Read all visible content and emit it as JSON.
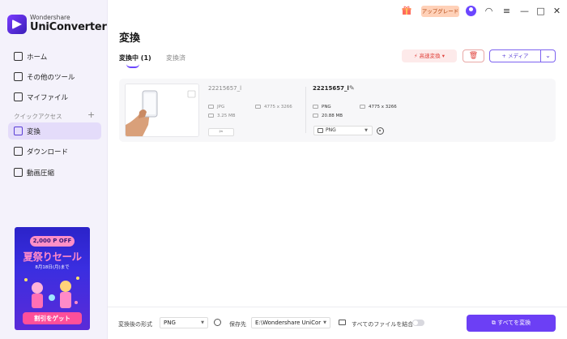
{
  "app": {
    "brand": "Wondershare",
    "name": "UniConverter"
  },
  "topbar": {
    "upgrade_label": "アップグレード"
  },
  "sidebar": {
    "items": [
      {
        "label": "ホーム",
        "icon": "home-icon"
      },
      {
        "label": "その他のツール",
        "icon": "toolbox-icon"
      },
      {
        "label": "マイファイル",
        "icon": "file-icon"
      }
    ],
    "section_label": "クイックアクセス",
    "quick_items": [
      {
        "label": "変換",
        "icon": "convert-icon",
        "active": true
      },
      {
        "label": "ダウンロード",
        "icon": "download-icon"
      },
      {
        "label": "動画圧縮",
        "icon": "compress-icon"
      }
    ]
  },
  "promo": {
    "pill": "2,000 P OFF",
    "title": "夏祭りセール",
    "date": "8月18日(月)まで",
    "button": "割引をゲット"
  },
  "main": {
    "title": "変換",
    "tabs": [
      {
        "label": "変換中 (1)",
        "active": true
      },
      {
        "label": "変換済",
        "active": false
      }
    ],
    "speed_label": "⚡ 高速変換 ▾",
    "trash_label": "🗑",
    "media_label": "+ メディア",
    "media_dropdown": "⌄"
  },
  "file": {
    "source": {
      "name": "22215657_l",
      "format": "JPG",
      "resolution": "4775 x 3266",
      "size": "3.25 MB"
    },
    "edit_label": "✂",
    "target": {
      "name": "22215657_l",
      "format": "PNG",
      "resolution": "4775 x 3266",
      "size": "20.88 MB",
      "output_format": "PNG"
    }
  },
  "bottom": {
    "format_label": "変換後の形式",
    "format_value": "PNG",
    "save_label": "保存先",
    "save_value": "E:\\Wondershare UniCor",
    "merge_label": "すべてのファイルを結合",
    "merge_enabled": false,
    "convert_all_label": "すべてを変換"
  },
  "colors": {
    "accent": "#6c3ff5",
    "sidebar_bg": "#f4f2fb",
    "danger": "#e0443e"
  }
}
